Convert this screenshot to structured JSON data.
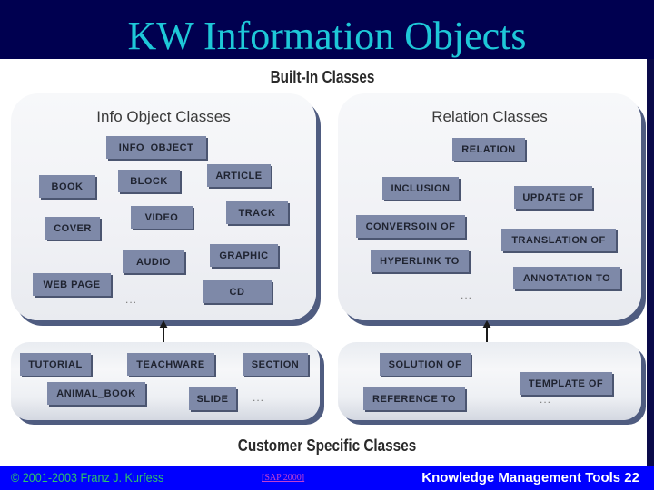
{
  "slide": {
    "title": "KW Information Objects"
  },
  "diagram": {
    "top_heading": "Built-In Classes",
    "bottom_heading": "Customer Specific Classes",
    "info_panel": {
      "title": "Info Object Classes",
      "classes": [
        "INFO_OBJECT",
        "BOOK",
        "BLOCK",
        "ARTICLE",
        "COVER",
        "VIDEO",
        "TRACK",
        "AUDIO",
        "GRAPHIC",
        "WEB PAGE",
        "CD"
      ],
      "ellipsis": "..."
    },
    "relation_panel": {
      "title": "Relation Classes",
      "classes": [
        "RELATION",
        "INCLUSION",
        "UPDATE OF",
        "CONVERSOIN OF",
        "TRANSLATION OF",
        "HYPERLINK TO",
        "ANNOTATION TO"
      ],
      "ellipsis": "..."
    },
    "customer_info_panel": {
      "classes": [
        "TUTORIAL",
        "TEACHWARE",
        "SECTION",
        "ANIMAL_BOOK",
        "SLIDE"
      ],
      "ellipsis": "..."
    },
    "customer_relation_panel": {
      "classes": [
        "SOLUTION OF",
        "TEMPLATE OF",
        "REFERENCE TO"
      ],
      "ellipsis": "..."
    }
  },
  "footer": {
    "copyright": "© 2001-2003 Franz J. Kurfess",
    "reference_link": "[SAP 2000]",
    "course_page": "Knowledge Management Tools 22"
  },
  "colors": {
    "title_bar": "#000050",
    "title_text": "#1ec8d8",
    "footer_bar": "#0000ff",
    "class_box": "#7e89a8",
    "panel_shadow": "#4f5c80"
  }
}
